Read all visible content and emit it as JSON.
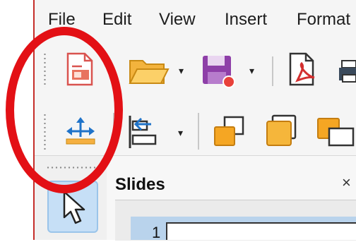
{
  "menu": {
    "file": "File",
    "edit": "Edit",
    "view": "View",
    "insert": "Insert",
    "format": "Format"
  },
  "toolbar1": {
    "icons": [
      "new-presentation-icon",
      "open-folder-icon",
      "save-icon",
      "export-pdf-icon",
      "print-icon"
    ],
    "dropdown_glyph": "▾"
  },
  "toolbar2": {
    "icons": [
      "position-and-size-icon",
      "align-objects-icon",
      "bring-forward-icon",
      "arrange-object-icon",
      "send-backward-icon"
    ],
    "dropdown_glyph": "▾"
  },
  "slides_panel": {
    "title": "Slides",
    "close": "×",
    "slide_number": "1"
  },
  "colors": {
    "annotation": "#e31015",
    "accent_orange": "#f5a623",
    "selected_bg": "#c6dff6"
  }
}
